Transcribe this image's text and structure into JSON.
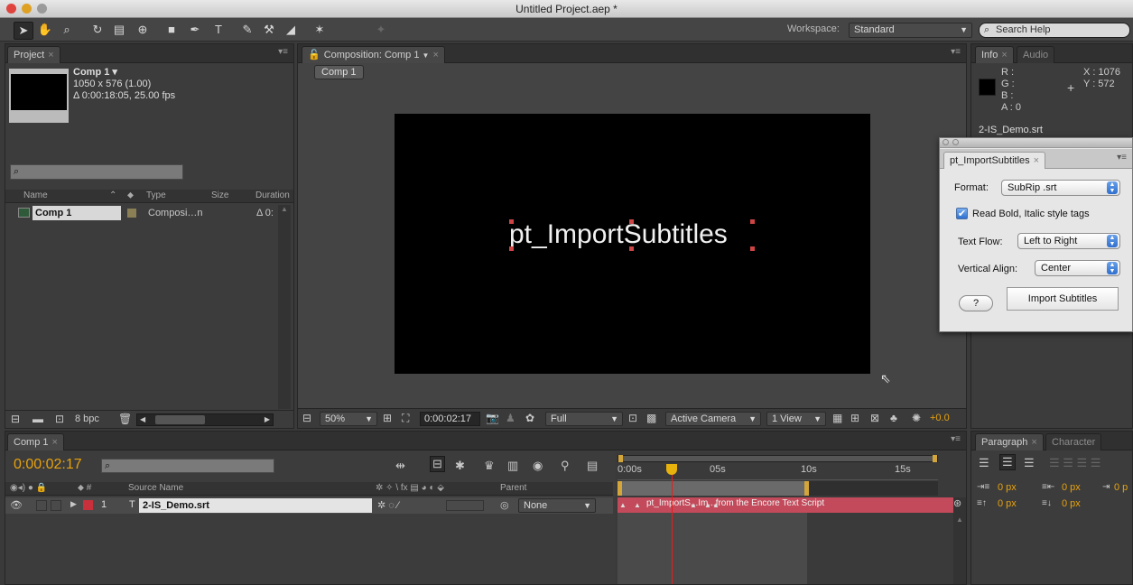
{
  "window": {
    "title": "Untitled Project.aep *"
  },
  "workspace": {
    "label": "Workspace:",
    "value": "Standard"
  },
  "search_help": {
    "placeholder": "Search Help"
  },
  "project_panel": {
    "tab": "Project",
    "comp_name": "Comp 1 ▾",
    "comp_size": "1050 x 576 (1.00)",
    "comp_duration": "Δ 0:00:18:05, 25.00 fps",
    "columns": [
      "Name",
      "Type",
      "Size",
      "Duration"
    ],
    "items": [
      {
        "name": "Comp 1",
        "type": "Composi…n",
        "duration": "Δ 0:"
      }
    ],
    "bpc": "8 bpc"
  },
  "composition_panel": {
    "tab": "Composition: Comp 1",
    "breadcrumb": "Comp 1",
    "canvas_text": "pt_ImportSubtitles",
    "zoom": "50%",
    "timecode": "0:00:02:17",
    "resolution": "Full",
    "camera": "Active Camera",
    "views": "1 View",
    "exposure": "+0.0"
  },
  "info_panel": {
    "tabs": [
      "Info",
      "Audio"
    ],
    "r": "R :",
    "g": "G :",
    "b": "B :",
    "a": "A : 0",
    "x": "X : 1076",
    "y": "Y : 572",
    "layer_name": "2-IS_Demo.srt"
  },
  "import_dialog": {
    "tab": "pt_ImportSubtitles",
    "format_label": "Format:",
    "format_value": "SubRip .srt",
    "style_tags_label": "Read Bold, Italic style tags",
    "style_tags_checked": true,
    "text_flow_label": "Text Flow:",
    "text_flow_value": "Left to Right",
    "vertical_align_label": "Vertical Align:",
    "vertical_align_value": "Center",
    "help_button": "?",
    "import_button": "Import Subtitles"
  },
  "timeline": {
    "tab": "Comp 1",
    "timecode": "0:00:02:17",
    "columns": {
      "source_name": "Source Name",
      "parent": "Parent"
    },
    "ruler": [
      "0:00s",
      "05s",
      "10s",
      "15s"
    ],
    "playhead_fraction": 0.165,
    "layers": [
      {
        "index": "1",
        "type_icon": "T",
        "name": "2-IS_Demo.srt",
        "parent": "None",
        "bar_text": "pt_ImportS...Im...from the Encore Text Script"
      }
    ]
  },
  "paragraph_panel": {
    "tabs": [
      "Paragraph",
      "Character"
    ],
    "indent_left": "0 px",
    "indent_right": "0 px",
    "indent_first": "0 p",
    "space_before": "0 px",
    "space_after": "0 px"
  },
  "colors": {
    "accent_orange": "#e8a20c",
    "layer_label": "#c8313b",
    "bar": "#c24a5a",
    "playhead": "#e02020"
  }
}
